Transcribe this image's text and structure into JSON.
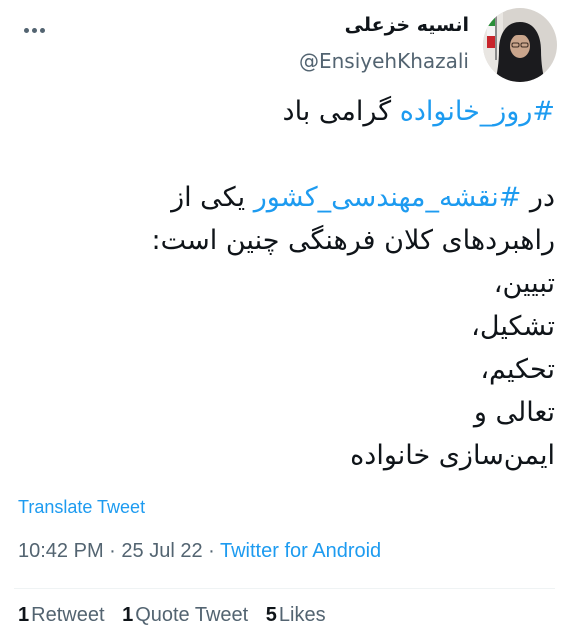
{
  "author": {
    "display_name": "انسیه خزعلی",
    "handle": "@EnsiyehKhazali"
  },
  "tweet": {
    "line1_hashtag": "#روز_خانواده",
    "line1_text": " گرامی باد",
    "line2_pre": "در ",
    "line2_hashtag": "#نقشه_مهندسی_کشور",
    "line2_post": " یکی از",
    "line3": "راهبردهای کلان فرهنگی چنین است:",
    "line4": "تبیین،",
    "line5": "تشکیل،",
    "line6": "تحکیم،",
    "line7": "تعالی و",
    "line8": "ایمن‌سازی خانواده"
  },
  "translate_label": "Translate Tweet",
  "meta": {
    "time": "10:42 PM",
    "sep1": " · ",
    "date": "25 Jul 22",
    "sep2": " · ",
    "source": "Twitter for Android"
  },
  "stats": {
    "retweets_count": "1",
    "retweets_label": "Retweet",
    "quotes_count": "1",
    "quotes_label": "Quote Tweet",
    "likes_count": "5",
    "likes_label": "Likes"
  },
  "colors": {
    "link": "#1d9bf0",
    "secondary": "#536471",
    "text": "#0f1419"
  }
}
